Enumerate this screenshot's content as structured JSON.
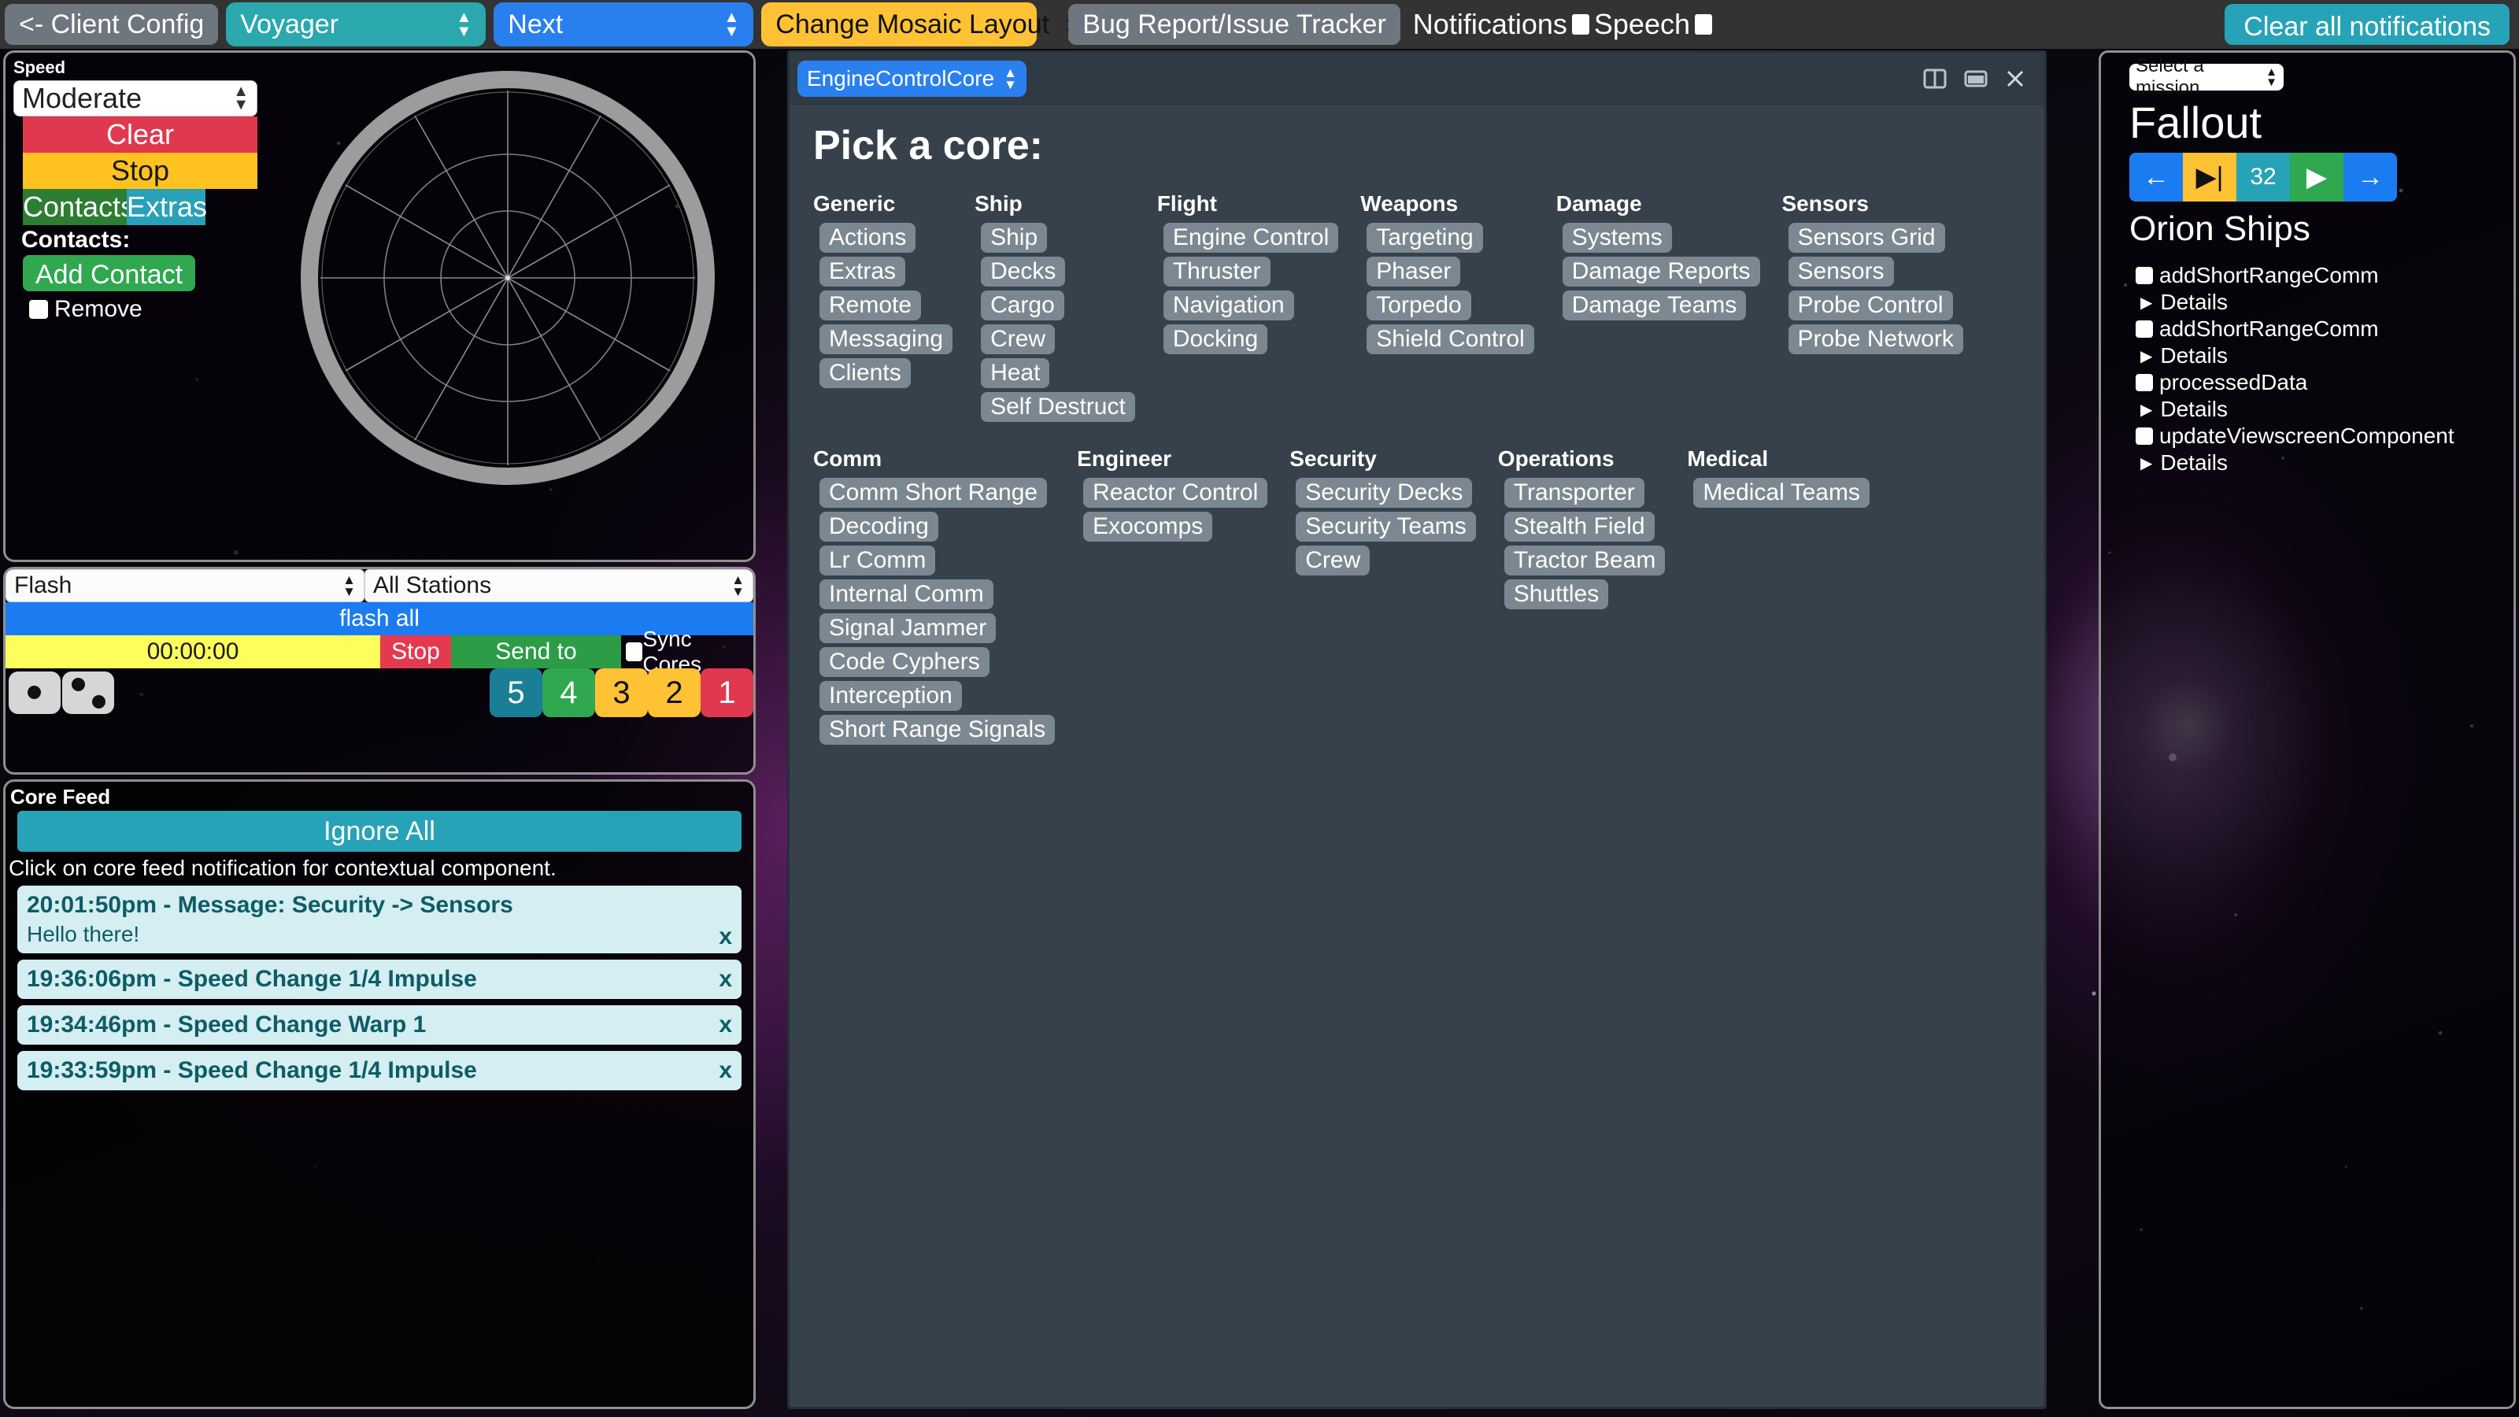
{
  "topbar": {
    "client_config_label": "<- Client Config",
    "ship_select": "Voyager",
    "next_select": "Next",
    "layout_select": "Change Mosaic Layout",
    "bug_report_label": "Bug Report/Issue Tracker",
    "notifications_label": "Notifications",
    "speech_label": "Speech",
    "clear_all_label": "Clear all notifications"
  },
  "sensors_panel": {
    "speed_label": "Speed",
    "speed_value": "Moderate",
    "clear_label": "Clear",
    "stop_label": "Stop",
    "tab_contacts": "Contacts",
    "tab_extras": "Extras",
    "contacts_label": "Contacts:",
    "add_contact_label": "Add Contact",
    "remove_label": "Remove"
  },
  "flash_panel": {
    "flash_select": "Flash",
    "stations_select": "All Stations",
    "flash_all_label": "flash all",
    "timer_value": "00:00:00",
    "stop_label": "Stop",
    "send_to_sensors_label": "Send to Sensors",
    "sync_cores_label": "Sync Cores",
    "number_buttons": [
      {
        "label": "5",
        "color": "#1a7f96"
      },
      {
        "label": "4",
        "color": "#2fa84f"
      },
      {
        "label": "3",
        "color": "#ffc235"
      },
      {
        "label": "2",
        "color": "#ffc235"
      },
      {
        "label": "1",
        "color": "#e0384f"
      }
    ]
  },
  "core_feed": {
    "title": "Core Feed",
    "ignore_all_label": "Ignore All",
    "hint": "Click on core feed notification for contextual component.",
    "close_label": "x",
    "items": [
      {
        "title": "20:01:50pm - Message: Security -> Sensors",
        "body": "Hello there!"
      },
      {
        "title": "19:36:06pm - Speed Change 1/4 Impulse",
        "body": ""
      },
      {
        "title": "19:34:46pm - Speed Change Warp 1",
        "body": ""
      },
      {
        "title": "19:33:59pm - Speed Change 1/4 Impulse",
        "body": ""
      }
    ]
  },
  "center_panel": {
    "core_select": "EngineControlCore",
    "heading": "Pick a core:",
    "rows": [
      [
        {
          "title": "Generic",
          "items": [
            "Actions",
            "Extras",
            "Remote",
            "Messaging",
            "Clients"
          ]
        },
        {
          "title": "Ship",
          "items": [
            "Ship",
            "Decks",
            "Cargo",
            "Crew",
            "Heat",
            "Self Destruct"
          ]
        },
        {
          "title": "Flight",
          "items": [
            "Engine Control",
            "Thruster",
            "Navigation",
            "Docking"
          ]
        },
        {
          "title": "Weapons",
          "items": [
            "Targeting",
            "Phaser",
            "Torpedo",
            "Shield Control"
          ]
        },
        {
          "title": "Damage",
          "items": [
            "Systems",
            "Damage Reports",
            "Damage Teams"
          ]
        },
        {
          "title": "Sensors",
          "items": [
            "Sensors Grid",
            "Sensors",
            "Probe Control",
            "Probe Network"
          ]
        }
      ],
      [
        {
          "title": "Comm",
          "items": [
            "Comm Short Range",
            "Decoding",
            "Lr Comm",
            "Internal Comm",
            "Signal Jammer",
            "Code Cyphers",
            "Interception",
            "Short Range Signals"
          ]
        },
        {
          "title": "Engineer",
          "items": [
            "Reactor Control",
            "Exocomps"
          ]
        },
        {
          "title": "Security",
          "items": [
            "Security Decks",
            "Security Teams",
            "Crew"
          ]
        },
        {
          "title": "Operations",
          "items": [
            "Transporter",
            "Stealth Field",
            "Tractor Beam",
            "Shuttles"
          ]
        },
        {
          "title": "Medical",
          "items": [
            "Medical Teams"
          ]
        }
      ]
    ]
  },
  "mission_panel": {
    "select_label": "Select a mission",
    "mission_name": "Fallout",
    "nav": {
      "prev": "←",
      "skip": "▶|",
      "count": "32",
      "play": "▶",
      "next": "→"
    },
    "section_title": "Orion Ships",
    "details_label": "Details",
    "tasks": [
      "addShortRangeComm",
      "addShortRangeComm",
      "processedData",
      "updateViewscreenComponent"
    ]
  },
  "colors": {
    "accent_teal": "#27a3b8",
    "accent_blue": "#1a7cf0",
    "accent_yellow": "#ffc235",
    "accent_green": "#2fa84f",
    "accent_red": "#e0384f",
    "panel_bg": "#36414c"
  }
}
